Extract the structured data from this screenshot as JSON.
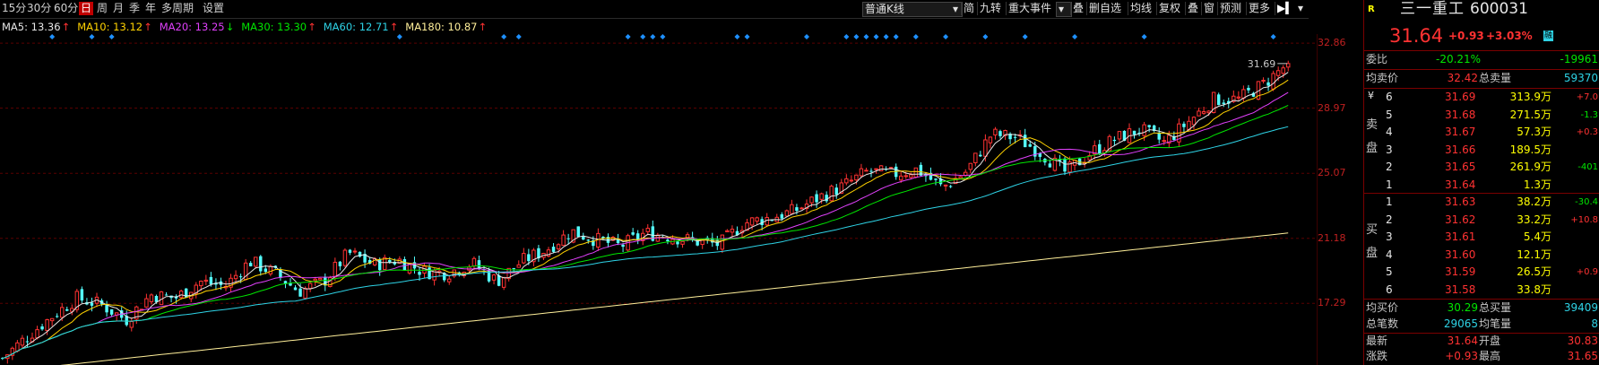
{
  "periods": [
    "15分",
    "30分",
    "60分",
    "日",
    "周",
    "月",
    "季",
    "年",
    "多周期",
    "设置"
  ],
  "active_period": "日",
  "toolbar": {
    "kline_type": "普通K线",
    "buttons": [
      "简",
      "九转",
      "重大事件",
      "叠",
      "删自选",
      "均线",
      "复权",
      "叠",
      "窗",
      "预测",
      "更多"
    ]
  },
  "ma_legend": [
    {
      "label": "MA5: 13.36",
      "arrow": "↑",
      "color": "#e6e6e6",
      "arrow_color": "#ff3232"
    },
    {
      "label": "MA10: 13.12",
      "arrow": "↑",
      "color": "#ffd200",
      "arrow_color": "#ff3232"
    },
    {
      "label": "MA20: 13.25",
      "arrow": "↓",
      "color": "#e040fb",
      "arrow_color": "#00e600"
    },
    {
      "label": "MA30: 13.30",
      "arrow": "↑",
      "color": "#00e600",
      "arrow_color": "#ff3232"
    },
    {
      "label": "MA60: 12.71",
      "arrow": "↑",
      "color": "#2ed3e6",
      "arrow_color": "#ff3232"
    },
    {
      "label": "MA180: 10.87",
      "arrow": "↑",
      "color": "#ffef9a",
      "arrow_color": "#ff3232"
    }
  ],
  "chart_data": {
    "type": "candlestick",
    "price_ticks": [
      "32.86",
      "28.97",
      "25.07",
      "21.18",
      "17.29"
    ],
    "ylim": [
      13.6,
      33.4
    ],
    "high_annotation": "31.69",
    "n_bars": 260,
    "close_series_approx": [
      14.0,
      15.3,
      16.5,
      17.6,
      17.2,
      16.3,
      17.8,
      17.6,
      18.6,
      18.3,
      19.8,
      19.1,
      18.0,
      18.6,
      20.3,
      19.6,
      19.9,
      19.2,
      19.1,
      19.7,
      18.6,
      19.8,
      20.5,
      21.6,
      21.1,
      20.7,
      21.5,
      21.3,
      21.0,
      20.8,
      22.1,
      22.4,
      22.8,
      23.6,
      24.3,
      25.2,
      25.0,
      25.3,
      24.2,
      25.2,
      27.4,
      27.2,
      26.3,
      25.1,
      26.3,
      27.1,
      27.7,
      26.9,
      28.2,
      29.5,
      29.5,
      30.4,
      31.64
    ]
  },
  "quote": {
    "code_flag": "R",
    "name": "三一重工",
    "code": "600031",
    "price": "31.64",
    "change": "+0.93",
    "change_pct": "+3.03%",
    "market_badge": "融",
    "wb_label": "委比",
    "wb_value": "-20.21%",
    "wc_value": "-19961",
    "avg_sell_label": "均卖价",
    "avg_sell_value": "32.42",
    "total_sell_label": "总卖量",
    "total_sell_value": "59370",
    "sell_side_label": "卖\n盘",
    "sell_rows": [
      {
        "lvl": "6",
        "price": "31.69",
        "vol": "313.9万",
        "chg": "+7.0"
      },
      {
        "lvl": "5",
        "price": "31.68",
        "vol": "271.5万",
        "chg": "-1.3"
      },
      {
        "lvl": "4",
        "price": "31.67",
        "vol": "57.3万",
        "chg": "+0.3"
      },
      {
        "lvl": "3",
        "price": "31.66",
        "vol": "189.5万",
        "chg": ""
      },
      {
        "lvl": "2",
        "price": "31.65",
        "vol": "261.9万",
        "chg": "-401"
      },
      {
        "lvl": "1",
        "price": "31.64",
        "vol": "1.3万",
        "chg": ""
      }
    ],
    "buy_side_label": "买\n盘",
    "buy_rows": [
      {
        "lvl": "1",
        "price": "31.63",
        "vol": "38.2万",
        "chg": "-30.4"
      },
      {
        "lvl": "2",
        "price": "31.62",
        "vol": "33.2万",
        "chg": "+10.8"
      },
      {
        "lvl": "3",
        "price": "31.61",
        "vol": "5.4万",
        "chg": ""
      },
      {
        "lvl": "4",
        "price": "31.60",
        "vol": "12.1万",
        "chg": ""
      },
      {
        "lvl": "5",
        "price": "31.59",
        "vol": "26.5万",
        "chg": "+0.9"
      },
      {
        "lvl": "6",
        "price": "31.58",
        "vol": "33.8万",
        "chg": ""
      }
    ],
    "avg_buy_label": "均买价",
    "avg_buy_value": "30.29",
    "total_buy_label": "总买量",
    "total_buy_value": "39409",
    "total_trades_label": "总笔数",
    "total_trades_value": "29065",
    "avg_trade_label": "均笔量",
    "avg_trade_value": "8",
    "latest_label": "最新",
    "latest_value": "31.64",
    "open_label": "开盘",
    "open_value": "30.83",
    "chg_label": "涨跌",
    "chg_value": "+0.93",
    "high_label": "最高",
    "high_value": "31.65"
  },
  "colors": {
    "up": "#ff3232",
    "down": "#54ffff",
    "grid": "#5a0000",
    "marker": "#1e90ff"
  }
}
